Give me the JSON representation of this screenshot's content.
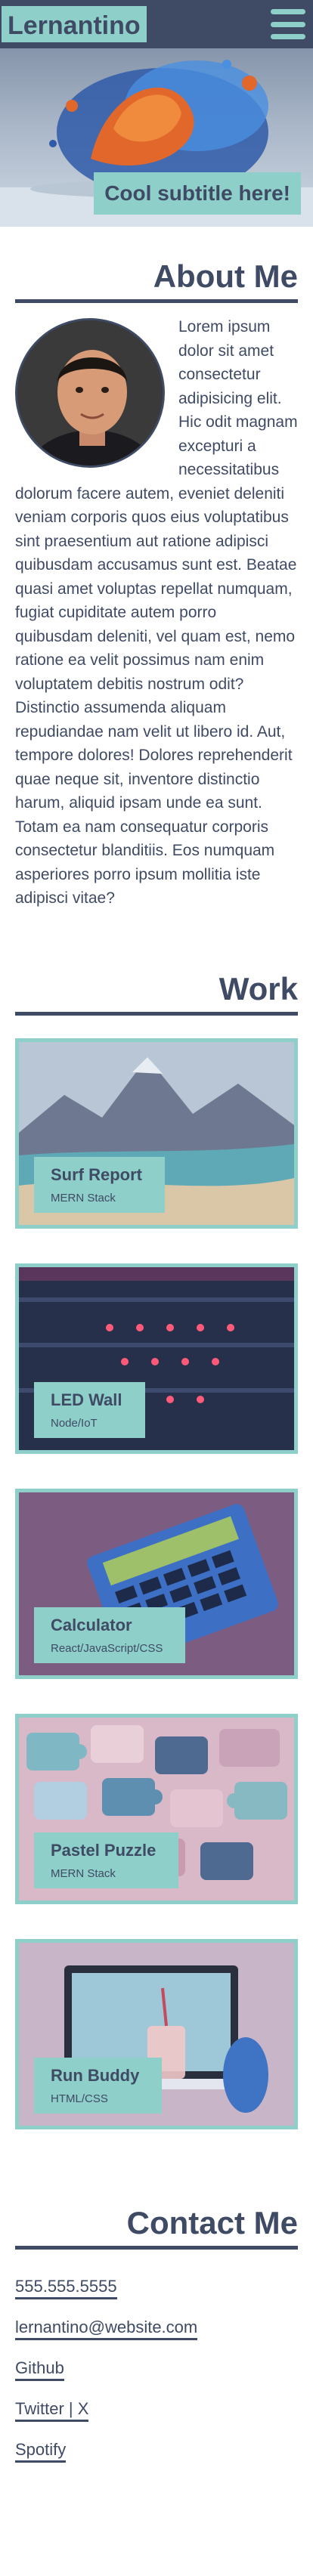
{
  "header": {
    "brand": "Lernantino",
    "subtitle": "Cool subtitle here!",
    "menu_icon": "hamburger-menu-icon"
  },
  "about": {
    "heading": "About Me",
    "body": "Lorem ipsum dolor sit amet consectetur adipisicing elit. Hic odit magnam excepturi a necessitatibus dolorum facere autem, eveniet deleniti veniam corporis quos eius voluptatibus sint praesentium aut ratione adipisci quibusdam accusamus sunt est. Beatae quasi amet voluptas repellat numquam, fugiat cupiditate autem porro quibusdam deleniti, vel quam est, nemo ratione ea velit possimus nam enim voluptatem debitis nostrum odit? Distinctio assumenda aliquam repudiandae nam velit ut libero id. Aut, tempore dolores! Dolores reprehenderit quae neque sit, inventore distinctio harum, aliquid ipsam unde ea sunt. Totam ea nam consequatur corporis consectetur blanditiis. Eos numquam asperiores porro ipsum mollitia iste adipisci vitae?"
  },
  "work": {
    "heading": "Work",
    "items": [
      {
        "title": "Surf Report",
        "tech": "MERN Stack"
      },
      {
        "title": "LED Wall",
        "tech": "Node/IoT"
      },
      {
        "title": "Calculator",
        "tech": "React/JavaScript/CSS"
      },
      {
        "title": "Pastel Puzzle",
        "tech": "MERN Stack"
      },
      {
        "title": "Run Buddy",
        "tech": "HTML/CSS"
      }
    ]
  },
  "contact": {
    "heading": "Contact Me",
    "links": [
      "555.555.5555",
      "lernantino@website.com",
      "Github",
      "Twitter | X",
      "Spotify"
    ]
  },
  "colors": {
    "primary": "#3f4a64",
    "accent": "#8ecfca",
    "background": "#ffffff"
  }
}
